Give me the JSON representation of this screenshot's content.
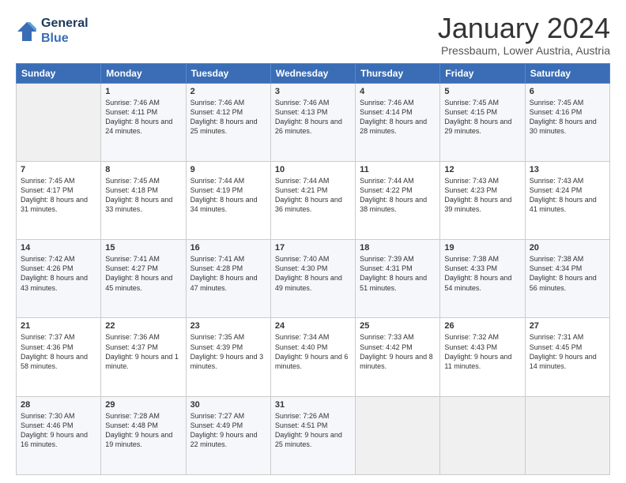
{
  "header": {
    "logo_line1": "General",
    "logo_line2": "Blue",
    "month_title": "January 2024",
    "location": "Pressbaum, Lower Austria, Austria"
  },
  "days_of_week": [
    "Sunday",
    "Monday",
    "Tuesday",
    "Wednesday",
    "Thursday",
    "Friday",
    "Saturday"
  ],
  "weeks": [
    [
      {
        "day": "",
        "sunrise": "",
        "sunset": "",
        "daylight": ""
      },
      {
        "day": "1",
        "sunrise": "Sunrise: 7:46 AM",
        "sunset": "Sunset: 4:11 PM",
        "daylight": "Daylight: 8 hours and 24 minutes."
      },
      {
        "day": "2",
        "sunrise": "Sunrise: 7:46 AM",
        "sunset": "Sunset: 4:12 PM",
        "daylight": "Daylight: 8 hours and 25 minutes."
      },
      {
        "day": "3",
        "sunrise": "Sunrise: 7:46 AM",
        "sunset": "Sunset: 4:13 PM",
        "daylight": "Daylight: 8 hours and 26 minutes."
      },
      {
        "day": "4",
        "sunrise": "Sunrise: 7:46 AM",
        "sunset": "Sunset: 4:14 PM",
        "daylight": "Daylight: 8 hours and 28 minutes."
      },
      {
        "day": "5",
        "sunrise": "Sunrise: 7:45 AM",
        "sunset": "Sunset: 4:15 PM",
        "daylight": "Daylight: 8 hours and 29 minutes."
      },
      {
        "day": "6",
        "sunrise": "Sunrise: 7:45 AM",
        "sunset": "Sunset: 4:16 PM",
        "daylight": "Daylight: 8 hours and 30 minutes."
      }
    ],
    [
      {
        "day": "7",
        "sunrise": "Sunrise: 7:45 AM",
        "sunset": "Sunset: 4:17 PM",
        "daylight": "Daylight: 8 hours and 31 minutes."
      },
      {
        "day": "8",
        "sunrise": "Sunrise: 7:45 AM",
        "sunset": "Sunset: 4:18 PM",
        "daylight": "Daylight: 8 hours and 33 minutes."
      },
      {
        "day": "9",
        "sunrise": "Sunrise: 7:44 AM",
        "sunset": "Sunset: 4:19 PM",
        "daylight": "Daylight: 8 hours and 34 minutes."
      },
      {
        "day": "10",
        "sunrise": "Sunrise: 7:44 AM",
        "sunset": "Sunset: 4:21 PM",
        "daylight": "Daylight: 8 hours and 36 minutes."
      },
      {
        "day": "11",
        "sunrise": "Sunrise: 7:44 AM",
        "sunset": "Sunset: 4:22 PM",
        "daylight": "Daylight: 8 hours and 38 minutes."
      },
      {
        "day": "12",
        "sunrise": "Sunrise: 7:43 AM",
        "sunset": "Sunset: 4:23 PM",
        "daylight": "Daylight: 8 hours and 39 minutes."
      },
      {
        "day": "13",
        "sunrise": "Sunrise: 7:43 AM",
        "sunset": "Sunset: 4:24 PM",
        "daylight": "Daylight: 8 hours and 41 minutes."
      }
    ],
    [
      {
        "day": "14",
        "sunrise": "Sunrise: 7:42 AM",
        "sunset": "Sunset: 4:26 PM",
        "daylight": "Daylight: 8 hours and 43 minutes."
      },
      {
        "day": "15",
        "sunrise": "Sunrise: 7:41 AM",
        "sunset": "Sunset: 4:27 PM",
        "daylight": "Daylight: 8 hours and 45 minutes."
      },
      {
        "day": "16",
        "sunrise": "Sunrise: 7:41 AM",
        "sunset": "Sunset: 4:28 PM",
        "daylight": "Daylight: 8 hours and 47 minutes."
      },
      {
        "day": "17",
        "sunrise": "Sunrise: 7:40 AM",
        "sunset": "Sunset: 4:30 PM",
        "daylight": "Daylight: 8 hours and 49 minutes."
      },
      {
        "day": "18",
        "sunrise": "Sunrise: 7:39 AM",
        "sunset": "Sunset: 4:31 PM",
        "daylight": "Daylight: 8 hours and 51 minutes."
      },
      {
        "day": "19",
        "sunrise": "Sunrise: 7:38 AM",
        "sunset": "Sunset: 4:33 PM",
        "daylight": "Daylight: 8 hours and 54 minutes."
      },
      {
        "day": "20",
        "sunrise": "Sunrise: 7:38 AM",
        "sunset": "Sunset: 4:34 PM",
        "daylight": "Daylight: 8 hours and 56 minutes."
      }
    ],
    [
      {
        "day": "21",
        "sunrise": "Sunrise: 7:37 AM",
        "sunset": "Sunset: 4:36 PM",
        "daylight": "Daylight: 8 hours and 58 minutes."
      },
      {
        "day": "22",
        "sunrise": "Sunrise: 7:36 AM",
        "sunset": "Sunset: 4:37 PM",
        "daylight": "Daylight: 9 hours and 1 minute."
      },
      {
        "day": "23",
        "sunrise": "Sunrise: 7:35 AM",
        "sunset": "Sunset: 4:39 PM",
        "daylight": "Daylight: 9 hours and 3 minutes."
      },
      {
        "day": "24",
        "sunrise": "Sunrise: 7:34 AM",
        "sunset": "Sunset: 4:40 PM",
        "daylight": "Daylight: 9 hours and 6 minutes."
      },
      {
        "day": "25",
        "sunrise": "Sunrise: 7:33 AM",
        "sunset": "Sunset: 4:42 PM",
        "daylight": "Daylight: 9 hours and 8 minutes."
      },
      {
        "day": "26",
        "sunrise": "Sunrise: 7:32 AM",
        "sunset": "Sunset: 4:43 PM",
        "daylight": "Daylight: 9 hours and 11 minutes."
      },
      {
        "day": "27",
        "sunrise": "Sunrise: 7:31 AM",
        "sunset": "Sunset: 4:45 PM",
        "daylight": "Daylight: 9 hours and 14 minutes."
      }
    ],
    [
      {
        "day": "28",
        "sunrise": "Sunrise: 7:30 AM",
        "sunset": "Sunset: 4:46 PM",
        "daylight": "Daylight: 9 hours and 16 minutes."
      },
      {
        "day": "29",
        "sunrise": "Sunrise: 7:28 AM",
        "sunset": "Sunset: 4:48 PM",
        "daylight": "Daylight: 9 hours and 19 minutes."
      },
      {
        "day": "30",
        "sunrise": "Sunrise: 7:27 AM",
        "sunset": "Sunset: 4:49 PM",
        "daylight": "Daylight: 9 hours and 22 minutes."
      },
      {
        "day": "31",
        "sunrise": "Sunrise: 7:26 AM",
        "sunset": "Sunset: 4:51 PM",
        "daylight": "Daylight: 9 hours and 25 minutes."
      },
      {
        "day": "",
        "sunrise": "",
        "sunset": "",
        "daylight": ""
      },
      {
        "day": "",
        "sunrise": "",
        "sunset": "",
        "daylight": ""
      },
      {
        "day": "",
        "sunrise": "",
        "sunset": "",
        "daylight": ""
      }
    ]
  ]
}
